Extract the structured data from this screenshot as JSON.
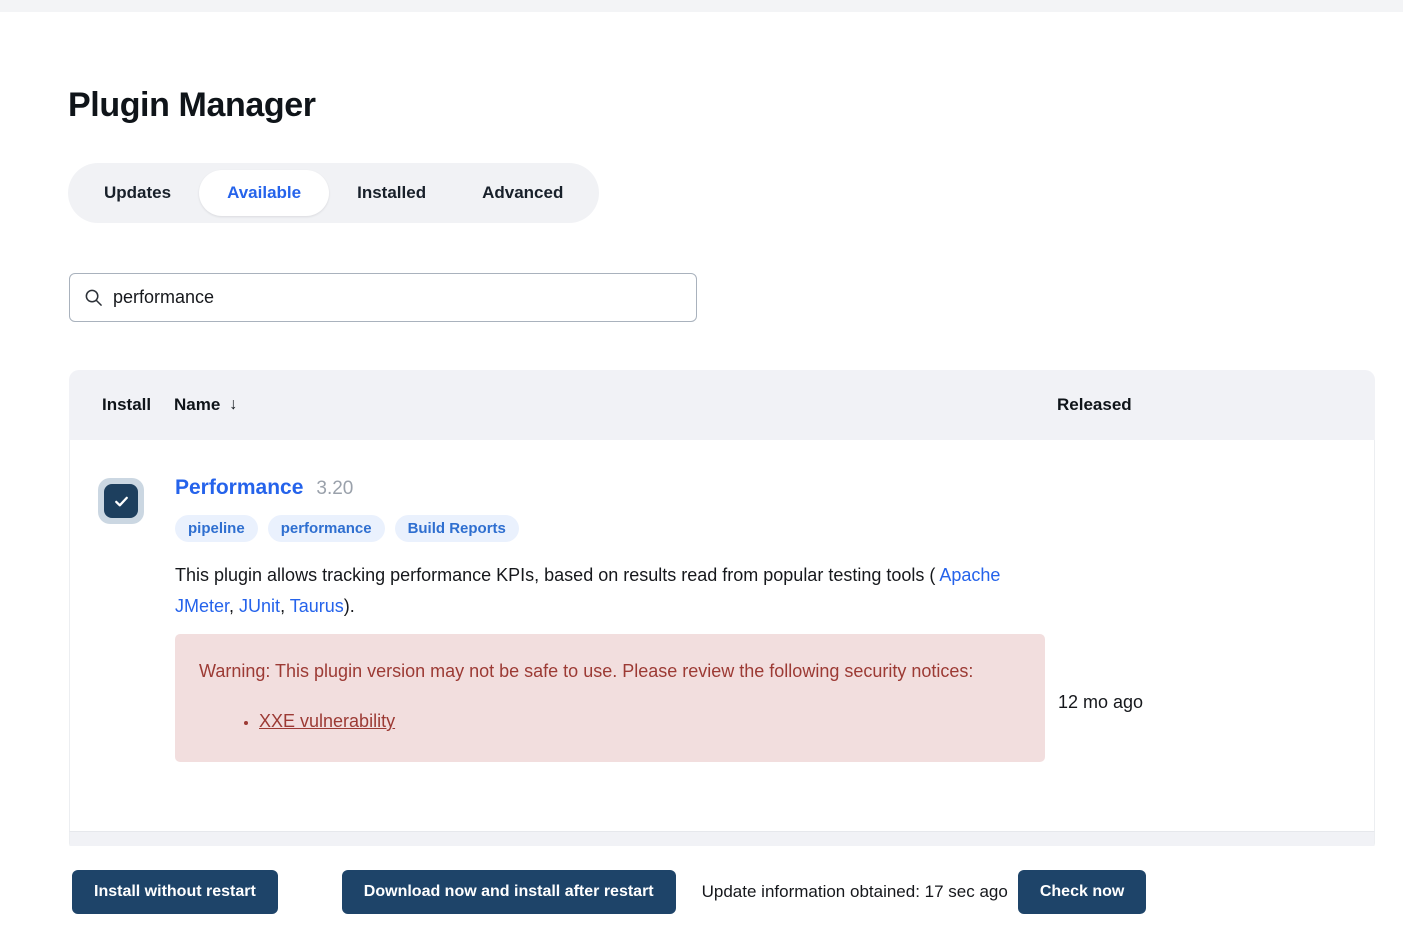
{
  "page": {
    "title": "Plugin Manager"
  },
  "tabs": [
    {
      "label": "Updates",
      "active": false
    },
    {
      "label": "Available",
      "active": true
    },
    {
      "label": "Installed",
      "active": false
    },
    {
      "label": "Advanced",
      "active": false
    }
  ],
  "search": {
    "value": "performance",
    "placeholder": "",
    "icon": "search-icon"
  },
  "table": {
    "columns": {
      "install": "Install",
      "name": "Name",
      "sort_indicator": "↓",
      "released": "Released"
    },
    "rows": [
      {
        "checked": true,
        "name": "Performance",
        "version": "3.20",
        "tags": [
          "pipeline",
          "performance",
          "Build Reports"
        ],
        "description_part1": "This plugin allows tracking performance KPIs, based on results read from popular testing tools ( ",
        "links": [
          "Apache JMeter",
          "JUnit",
          "Taurus"
        ],
        "description_sep1": ", ",
        "description_sep2": ", ",
        "description_part2": ").",
        "warning": {
          "text": "Warning: This plugin version may not be safe to use. Please review the following security notices:",
          "notices": [
            "XXE vulnerability"
          ]
        },
        "released": "12 mo ago"
      }
    ]
  },
  "footer": {
    "install_without_restart": "Install without restart",
    "download_and_install_after_restart": "Download now and install after restart",
    "update_status": "Update information obtained: 17 sec ago",
    "check_now": "Check now"
  },
  "colors": {
    "accent_blue": "#2563eb",
    "button_navy": "#1e4469",
    "checkbox_navy": "#1d3f5e",
    "warning_bg": "#f2dede",
    "warning_text": "#9c3a34",
    "tag_bg": "#eaf1fd",
    "tag_text": "#2f6fd0",
    "header_bg": "#f1f2f6"
  }
}
